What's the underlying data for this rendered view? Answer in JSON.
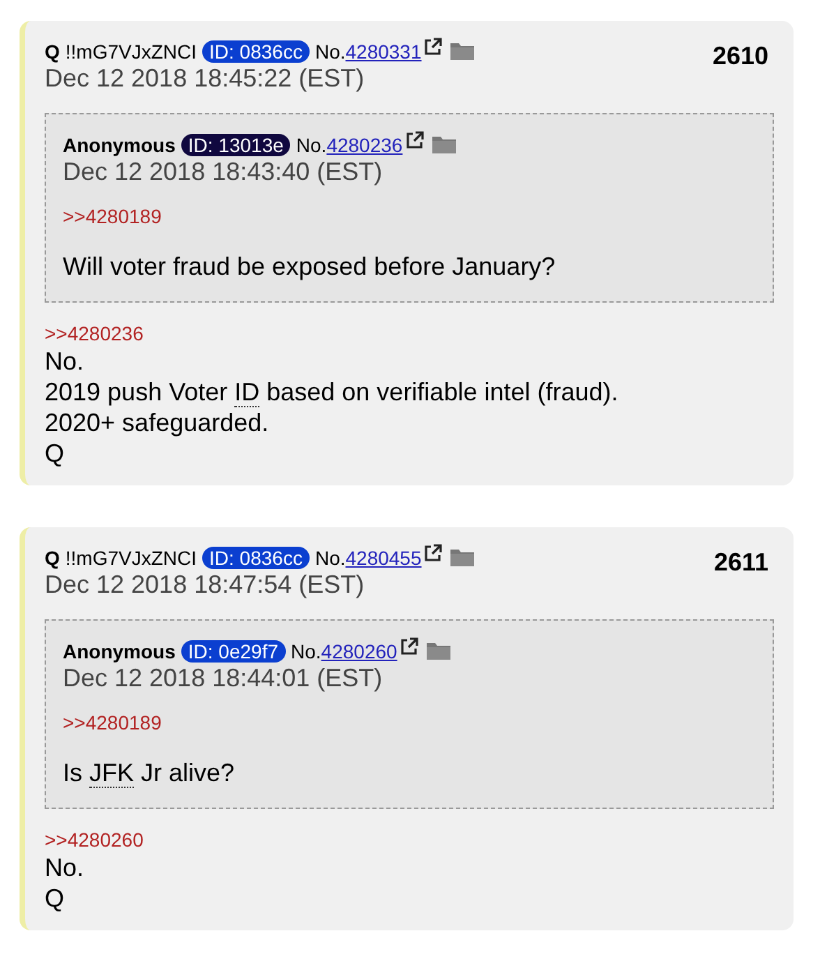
{
  "posts": [
    {
      "name": "Q",
      "tripcode": "!!mG7VJxZNCI",
      "id_badge": {
        "text": "ID: 0836cc",
        "color": "#0b3fd0"
      },
      "no_label": "No.",
      "post_number": "4280331",
      "date": "Dec 12 2018 18:45:22 (EST)",
      "index": "2610",
      "quote": {
        "name": "Anonymous",
        "id_badge": {
          "text": "ID: 13013e",
          "color": "#10083f"
        },
        "no_label": "No.",
        "post_number": "4280236",
        "date": "Dec 12 2018 18:43:40 (EST)",
        "reply_link": ">>4280189",
        "lines": [
          [
            {
              "text": "Will voter fraud be exposed before January?",
              "abbr": false
            }
          ]
        ]
      },
      "reply_link": ">>4280236",
      "lines": [
        [
          {
            "text": "No.",
            "abbr": false
          }
        ],
        [
          {
            "text": "2019 push Voter ",
            "abbr": false
          },
          {
            "text": "ID",
            "abbr": true
          },
          {
            "text": " based on verifiable intel (fraud).",
            "abbr": false
          }
        ],
        [
          {
            "text": "2020+ safeguarded.",
            "abbr": false
          }
        ],
        [
          {
            "text": "Q",
            "abbr": false
          }
        ]
      ]
    },
    {
      "name": "Q",
      "tripcode": "!!mG7VJxZNCI",
      "id_badge": {
        "text": "ID: 0836cc",
        "color": "#0b3fd0"
      },
      "no_label": "No.",
      "post_number": "4280455",
      "date": "Dec 12 2018 18:47:54 (EST)",
      "index": "2611",
      "quote": {
        "name": "Anonymous",
        "id_badge": {
          "text": "ID: 0e29f7",
          "color": "#0b3fd0"
        },
        "no_label": "No.",
        "post_number": "4280260",
        "date": "Dec 12 2018 18:44:01 (EST)",
        "reply_link": ">>4280189",
        "lines": [
          [
            {
              "text": "Is ",
              "abbr": false
            },
            {
              "text": "JFK",
              "abbr": true
            },
            {
              "text": " Jr alive?",
              "abbr": false
            }
          ]
        ]
      },
      "reply_link": ">>4280260",
      "lines": [
        [
          {
            "text": "No.",
            "abbr": false
          }
        ],
        [
          {
            "text": "Q",
            "abbr": false
          }
        ]
      ]
    }
  ]
}
